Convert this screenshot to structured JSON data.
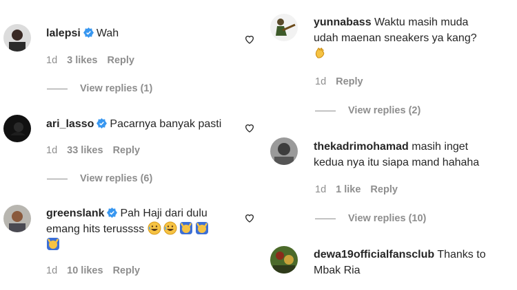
{
  "left": [
    {
      "username": "lalepsi",
      "verified": true,
      "text": "Wah",
      "time": "1d",
      "likes": "3 likes",
      "reply": "Reply",
      "view_replies": "View replies (1)"
    },
    {
      "username": "ari_lasso",
      "verified": true,
      "text": "Pacarnya banyak pasti",
      "time": "1d",
      "likes": "33 likes",
      "reply": "Reply",
      "view_replies": "View replies (6)"
    },
    {
      "username": "greenslank",
      "verified": true,
      "text_line1": "Pah Haji dari dulu",
      "text_line2": "emang hits terussss",
      "time": "1d",
      "likes": "10 likes",
      "reply": "Reply"
    }
  ],
  "right": [
    {
      "username": "yunnabass",
      "text_line1": "Waktu masih muda",
      "text_line2": "udah maenan sneakers ya kang?",
      "time": "1d",
      "reply": "Reply",
      "view_replies": "View replies (2)"
    },
    {
      "username": "thekadrimohamad",
      "text_line1": "masih inget",
      "text_line2": "kedua nya itu siapa mand hahaha",
      "time": "1d",
      "likes": "1 like",
      "reply": "Reply",
      "view_replies": "View replies (10)"
    },
    {
      "username": "dewa19officialfansclub",
      "text_line1": "Thanks to",
      "text_line2": "Mbak Ria"
    }
  ],
  "icons": {
    "heart": "heart-outline-icon",
    "verified": "verified-badge-icon",
    "emoji_laugh": "grinning-sweat-emoji-icon",
    "emoji_clap": "clapping-hands-emoji-icon",
    "emoji_raised": "raising-hands-emoji-icon"
  },
  "colors": {
    "text": "#262626",
    "muted": "#8e8e8e",
    "verified": "#3897f0"
  }
}
